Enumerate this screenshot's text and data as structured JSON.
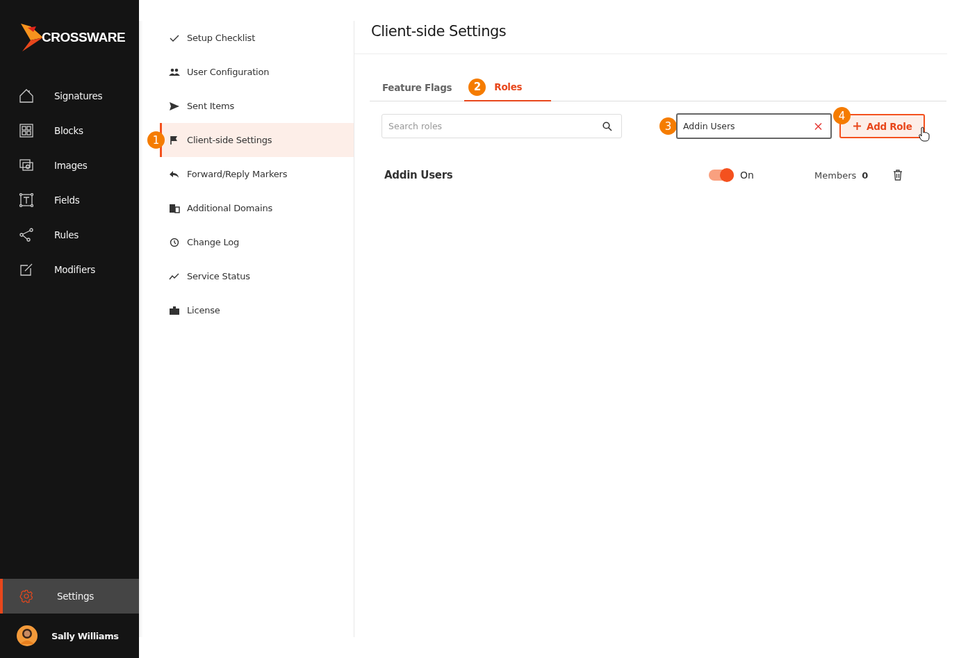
{
  "sidebar": {
    "logo": "CROSSWARE",
    "items": [
      {
        "label": "Signatures",
        "selected": false
      },
      {
        "label": "Blocks",
        "selected": false
      },
      {
        "label": "Images",
        "selected": false
      },
      {
        "label": "Fields",
        "selected": false
      },
      {
        "label": "Rules",
        "selected": false
      },
      {
        "label": "Modifiers",
        "selected": false
      }
    ],
    "settings": {
      "label": "Settings",
      "selected": true
    },
    "user": {
      "name": "Sally Williams"
    }
  },
  "subnav": {
    "items": [
      {
        "label": "Setup Checklist",
        "selected": false
      },
      {
        "label": "User Configuration",
        "selected": false
      },
      {
        "label": "Sent Items",
        "selected": false
      },
      {
        "label": "Client-side Settings",
        "selected": true,
        "callout": "1"
      },
      {
        "label": "Forward/Reply Markers",
        "selected": false
      },
      {
        "label": "Additional Domains",
        "selected": false
      },
      {
        "label": "Change Log",
        "selected": false
      },
      {
        "label": "Service Status",
        "selected": false
      },
      {
        "label": "License",
        "selected": false
      }
    ]
  },
  "page": {
    "title": "Client-side Settings"
  },
  "tabs": [
    {
      "label": "Feature Flags",
      "selected": false
    },
    {
      "label": "Roles",
      "selected": true,
      "callout": "2"
    }
  ],
  "search": {
    "placeholder": "Search roles"
  },
  "new_role": {
    "value": "Addin Users",
    "callout": "3"
  },
  "add_button": {
    "label": "Add Role",
    "callout": "4"
  },
  "roles": [
    {
      "name": "Addin Users",
      "on": true,
      "state_label": "On",
      "members_label": "Members",
      "members": "0"
    }
  ]
}
